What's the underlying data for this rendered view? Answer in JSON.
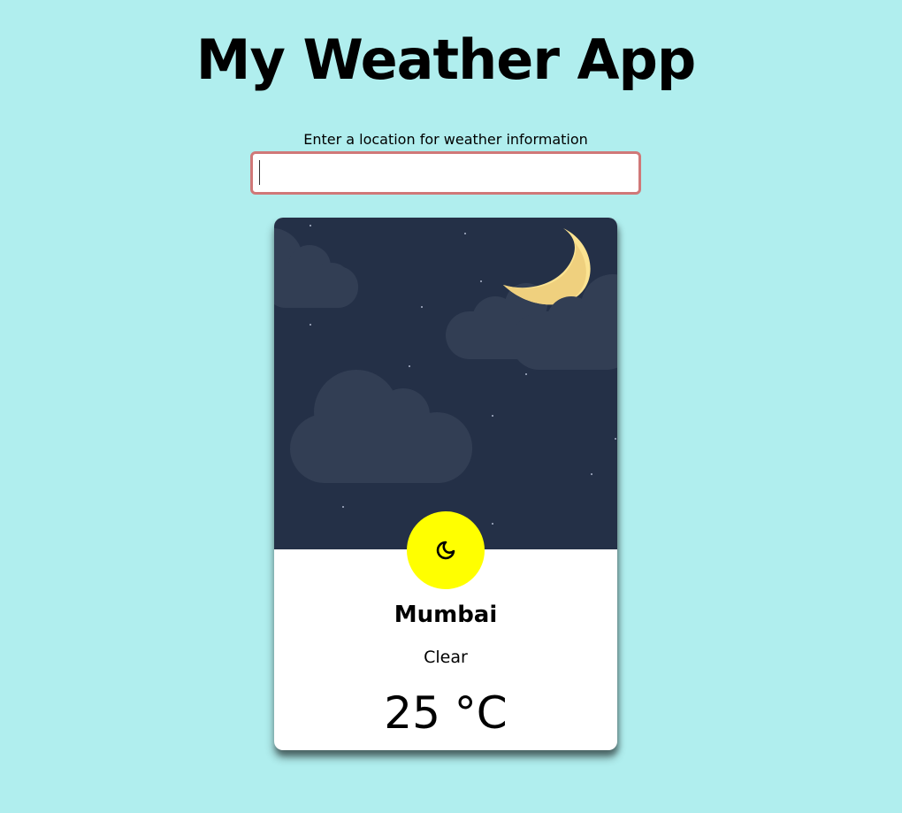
{
  "app": {
    "title": "My Weather App"
  },
  "search": {
    "label": "Enter a location for weather information",
    "value": "",
    "placeholder": ""
  },
  "weather": {
    "city": "Mumbai",
    "condition": "Clear",
    "temperature": "25 °C",
    "icon": "moon-icon",
    "scene": "night-sky-with-moon-and-clouds"
  },
  "colors": {
    "background": "#b0eeee",
    "sky": "#243047",
    "cloud": "#323e54",
    "moon": "#fbe391",
    "icon_badge": "#ffff00",
    "input_border": "#d07878"
  }
}
